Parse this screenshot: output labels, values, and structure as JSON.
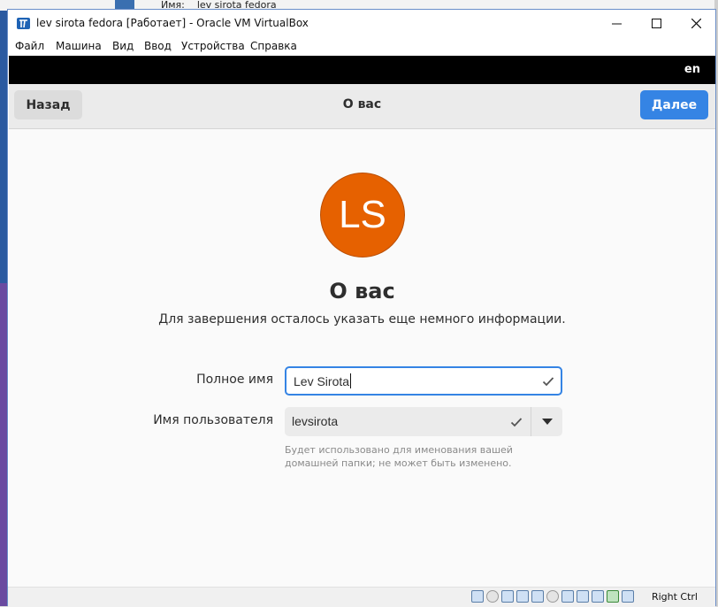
{
  "background": {
    "peek_label": "Имя:    lev sirota fedora"
  },
  "window": {
    "title": "lev sirota fedora [Работает] - Oracle VM VirtualBox",
    "menu": [
      "Файл",
      "Машина",
      "Вид",
      "Ввод",
      "Устройства",
      "Справка"
    ]
  },
  "guest": {
    "topbar": {
      "language": "en"
    },
    "header": {
      "back_label": "Назад",
      "title": "О вас",
      "next_label": "Далее"
    },
    "avatar_initials": "LS",
    "heading": "О вас",
    "subtitle": "Для завершения осталось указать еще немного информации.",
    "form": {
      "full_name_label": "Полное имя",
      "full_name_value": "Lev Sirota",
      "username_label": "Имя пользователя",
      "username_value": "levsirota",
      "username_hint": "Будет использовано для именования вашей домашней папки; не может быть изменено."
    }
  },
  "statusbar": {
    "host_key": "Right Ctrl"
  },
  "colors": {
    "accent": "#3584e4",
    "avatar": "#e66100",
    "topbar": "#000000"
  }
}
